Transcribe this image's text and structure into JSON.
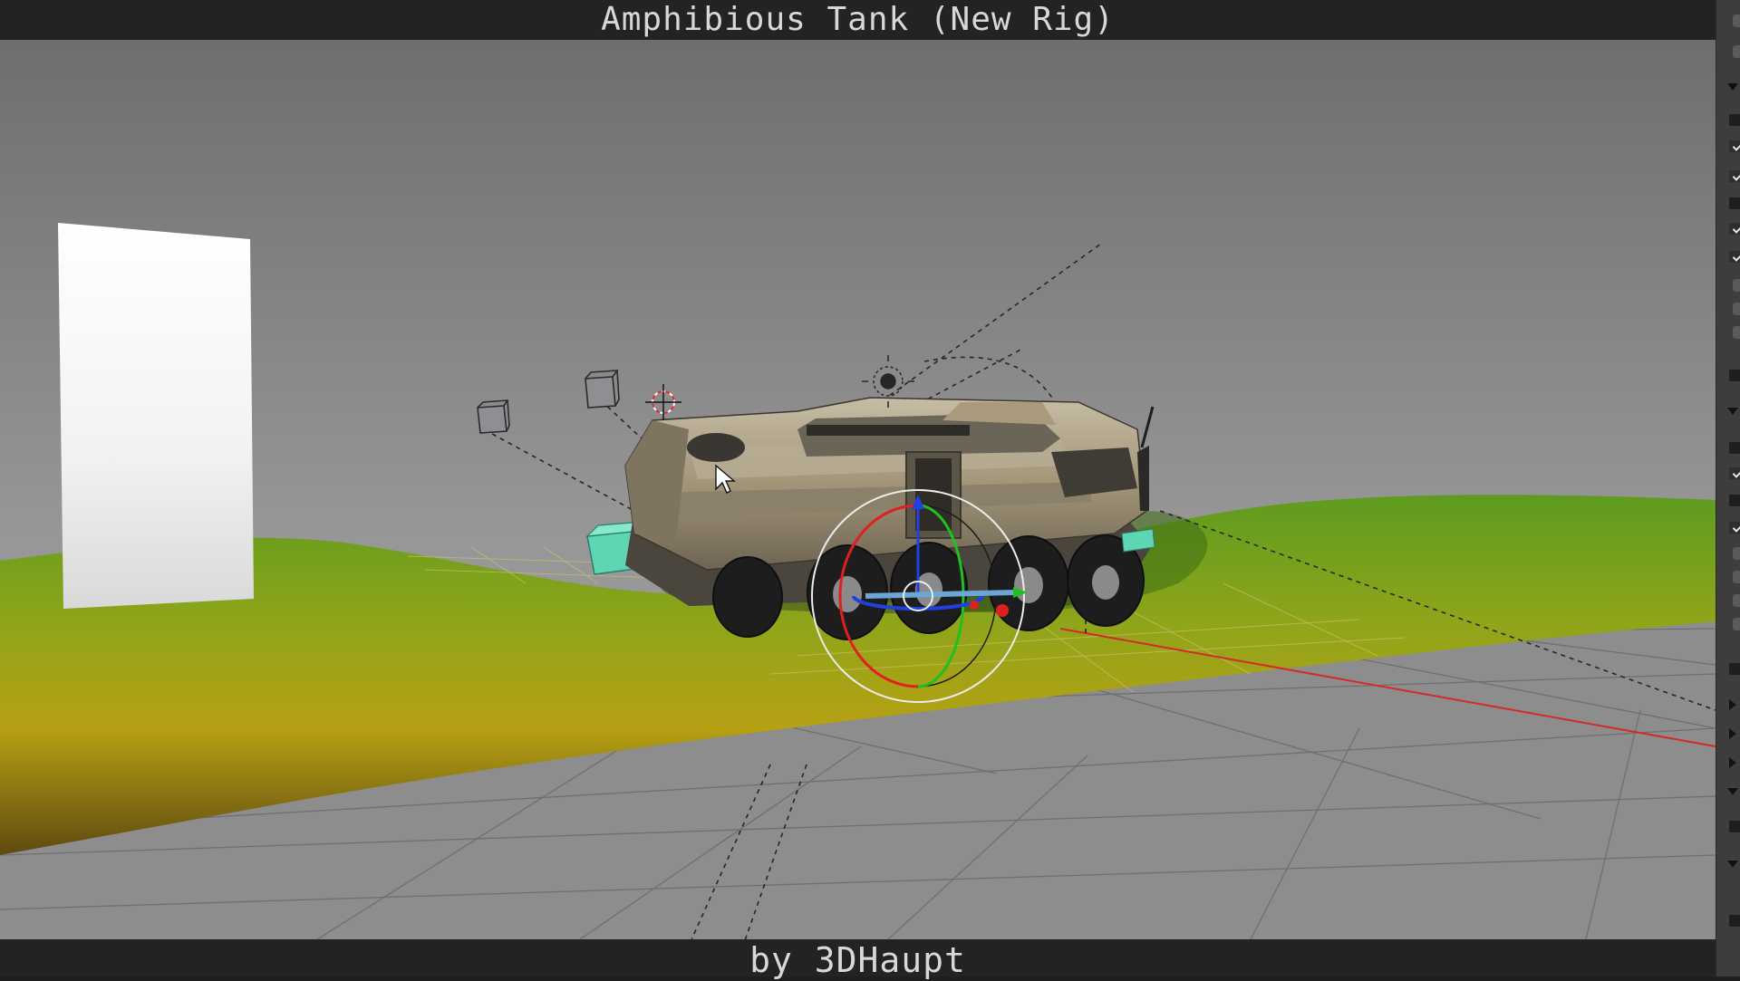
{
  "header": {
    "title": "Amphibious Tank (New Rig)"
  },
  "footer": {
    "credit": "by 3DHaupt"
  },
  "viewport": {
    "scene": "tank-rig",
    "colors": {
      "sky_top": "#6f6f6f",
      "sky_bottom": "#9a9a9a",
      "floor": "#8b8b8b",
      "terrain_green": "#5f9a20",
      "terrain_yellow": "#b9a413",
      "terrain_dark": "#5c4710",
      "tank_body": "#a69a80",
      "axis_x": "#e02020",
      "axis_y": "#20c020",
      "axis_z": "#2040e0"
    }
  },
  "side_panel": {
    "icons": [
      "triangle-down-icon",
      "checkbox-icon",
      "triangle-right-icon"
    ]
  }
}
